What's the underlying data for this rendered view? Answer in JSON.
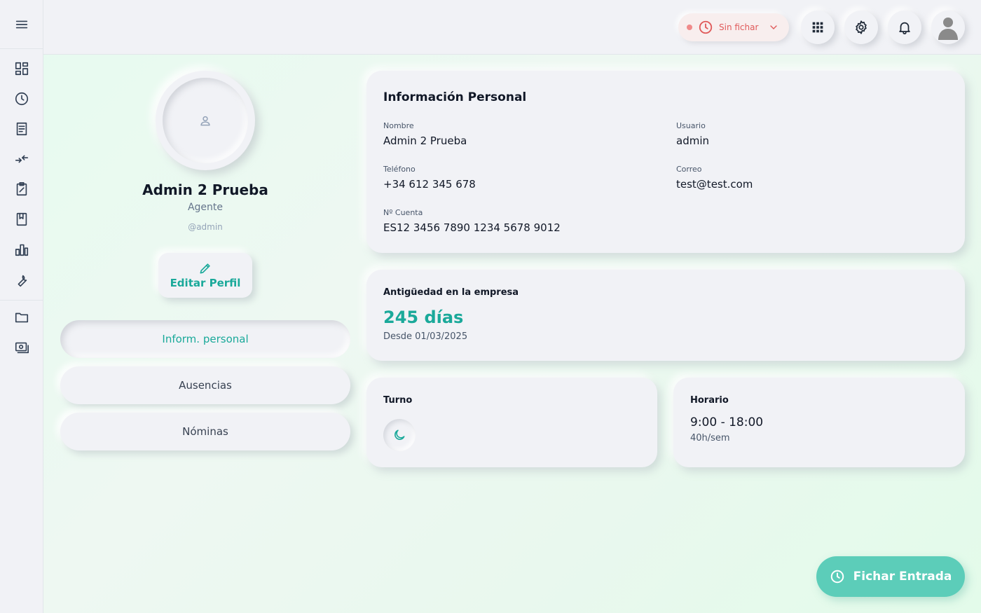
{
  "header": {
    "clock_status": "Sin fichar"
  },
  "profile": {
    "name": "Admin 2 Prueba",
    "role": "Agente",
    "handle": "@admin",
    "edit_label": "Editar Perfil"
  },
  "tabs": [
    {
      "label": "Inform. personal",
      "active": true
    },
    {
      "label": "Ausencias",
      "active": false
    },
    {
      "label": "Nóminas",
      "active": false
    }
  ],
  "personal_info": {
    "title": "Información Personal",
    "name_label": "Nombre",
    "name_value": "Admin 2 Prueba",
    "user_label": "Usuario",
    "user_value": "admin",
    "phone_label": "Teléfono",
    "phone_value": "+34 612 345 678",
    "email_label": "Correo",
    "email_value": "test@test.com",
    "account_label": "Nº Cuenta",
    "account_value": "ES12 3456 7890 1234 5678 9012"
  },
  "seniority": {
    "title": "Antigüedad en la empresa",
    "days": "245 días",
    "since": "Desde 01/03/2025"
  },
  "shift": {
    "title": "Turno"
  },
  "schedule": {
    "title": "Horario",
    "hours": "9:00 - 18:00",
    "weekly": "40h/sem"
  },
  "fichar": {
    "label": "Fichar Entrada"
  },
  "colors": {
    "accent": "#1aa99a",
    "fichar_button": "#5ccdb9",
    "status_red": "#e05a5a"
  }
}
